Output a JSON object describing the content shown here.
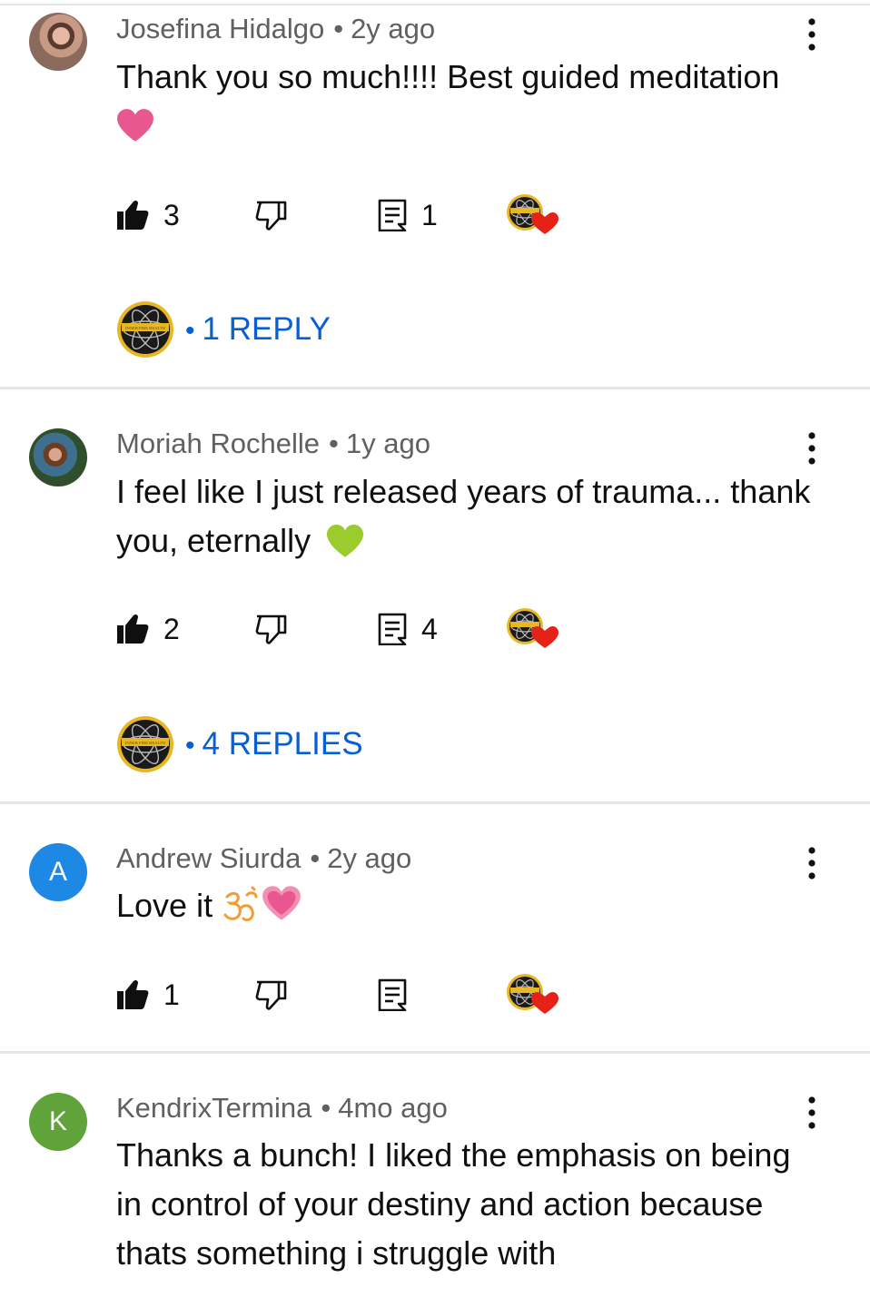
{
  "comments": [
    {
      "author": "Josefina Hidalgo",
      "age": "2y ago",
      "text": "Thank you so much!!!! Best guided meditation",
      "likes": "3",
      "reply_count": "1",
      "replies_label": "1 REPLY",
      "emoji": "pink-heart"
    },
    {
      "author": "Moriah Rochelle",
      "age": "1y ago",
      "text": "I feel like I just released years of trauma... thank you, eternally",
      "likes": "2",
      "reply_count": "4",
      "replies_label": "4 REPLIES",
      "emoji": "green-heart"
    },
    {
      "author": "Andrew Siurda",
      "age": "2y ago",
      "text": "Love it",
      "avatar_letter": "A",
      "likes": "1",
      "emoji": "om-and-sparkling-heart"
    },
    {
      "author": "KendrixTermina",
      "age": "4mo ago",
      "text": "Thanks a bunch! I liked the emphasis on being in control of your destiny and action because thats something i struggle with",
      "avatar_letter": "K"
    }
  ],
  "separator": "•",
  "channel_logo_text": "INNER FIRE HEALTH",
  "colors": {
    "link_blue": "#065fd4",
    "avatar_a": "#1e88e5",
    "avatar_k": "#5fa33a",
    "heart_red": "#e62117",
    "logo_gold": "#e8b823",
    "pink_heart": "#e8578f",
    "green_heart": "#9bcc2e"
  }
}
